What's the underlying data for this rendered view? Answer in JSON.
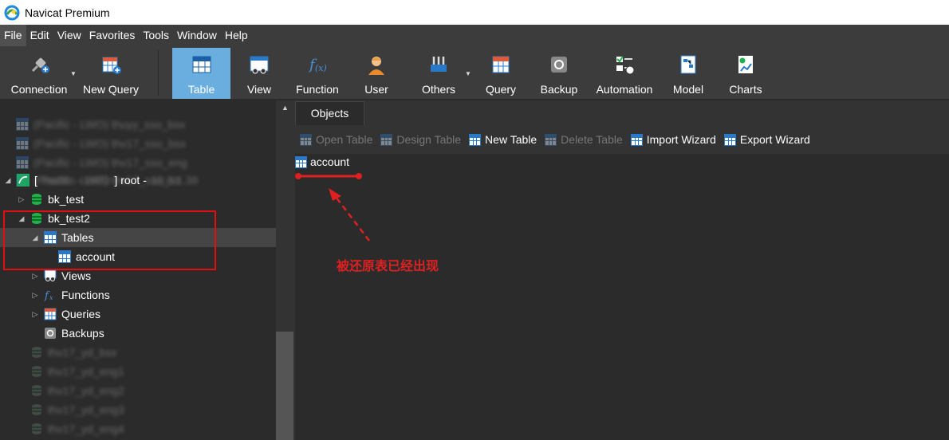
{
  "window": {
    "title": "Navicat Premium"
  },
  "menu": [
    "File",
    "Edit",
    "View",
    "Favorites",
    "Tools",
    "Window",
    "Help"
  ],
  "toolbar": {
    "connection": "Connection",
    "new_query": "New Query",
    "table": "Table",
    "view": "View",
    "function": "Function",
    "user": "User",
    "others": "Others",
    "query": "Query",
    "backup": "Backup",
    "automation": "Automation",
    "model": "Model",
    "charts": "Charts"
  },
  "tree": {
    "blurred_top": [
      "(Pacific - LWO) thuyy_sso_bsx",
      "(Pacific - LWO) thv17_sso_bsx",
      "(Pacific - LWO) thv17_sso_eng",
      "(Pacific - LWO) thv17_sso_str"
    ],
    "connection_prefix": "[",
    "connection_blur": "Pacific - LWO",
    "connection_mid": "] root -",
    "connection_tail": "10.0.1.38",
    "db1": "bk_test",
    "db2": "bk_test2",
    "tables": "Tables",
    "account": "account",
    "views": "Views",
    "functions": "Functions",
    "queries": "Queries",
    "backups": "Backups",
    "blurred_bottom": [
      "thv17_yd_bsx",
      "thv17_yd_eng1",
      "thv17_yd_eng2",
      "thv17_yd_eng3",
      "thv17_yd_eng4"
    ]
  },
  "tabs": {
    "objects": "Objects"
  },
  "object_toolbar": {
    "open_table": "Open Table",
    "design_table": "Design Table",
    "new_table": "New Table",
    "delete_table": "Delete Table",
    "import_wizard": "Import Wizard",
    "export_wizard": "Export Wizard"
  },
  "objects": {
    "item": "account"
  },
  "annotation": {
    "text": "被还原表已经出现",
    "color": "#e02020"
  },
  "colors": {
    "accent": "#6aaee0",
    "highlight": "#e01010"
  }
}
